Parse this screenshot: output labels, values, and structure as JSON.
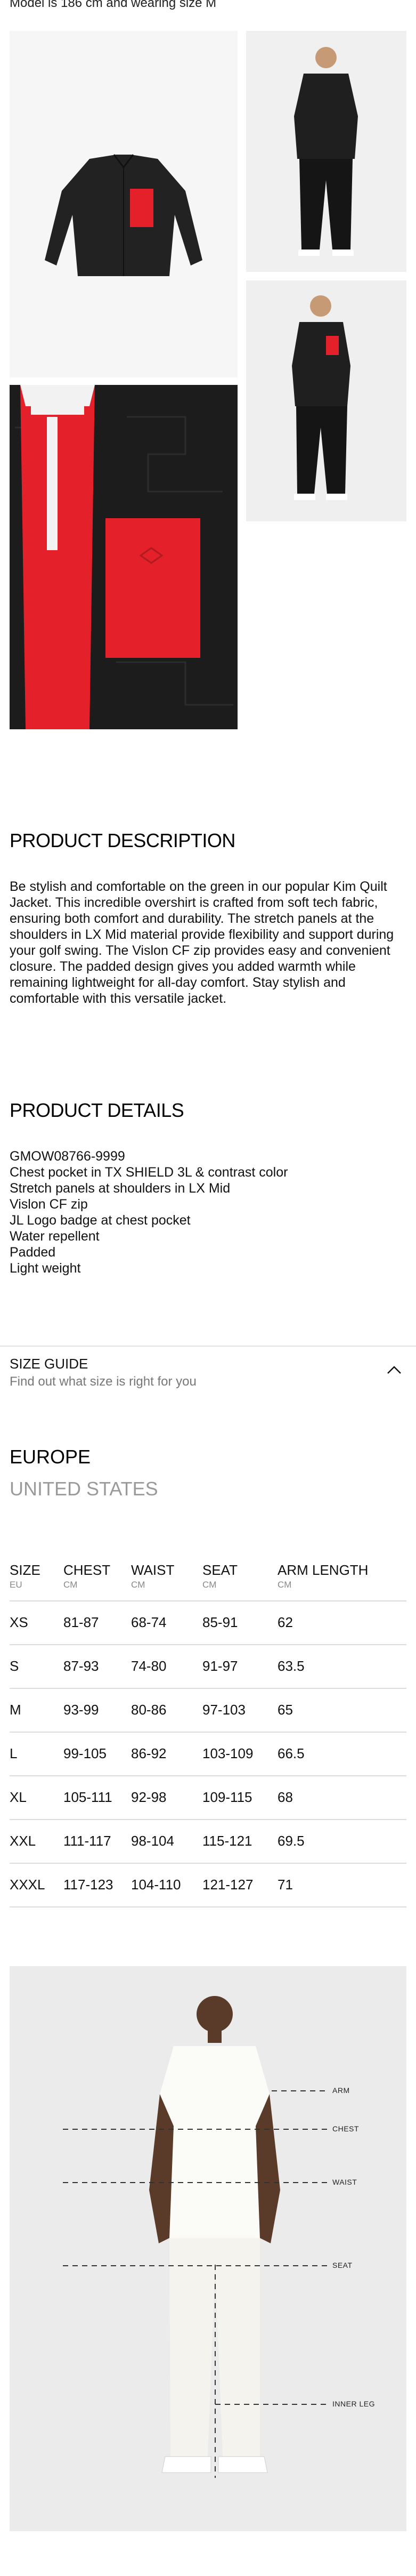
{
  "product": {
    "model_note": "Model is 186 cm and wearing size M",
    "description_title": "PRODUCT DESCRIPTION",
    "description": "Be stylish and comfortable on the green in our popular Kim Quilt Jacket. This incredible overshirt is crafted from soft tech fabric, ensuring both comfort and durability. The stretch panels at the shoulders in LX Mid material provide flexibility and support during your golf swing. The Vislon CF zip provides easy and convenient closure. The padded design gives you added warmth while remaining lightweight for all-day comfort. Stay stylish and comfortable with this versatile jacket.",
    "details_title": "PRODUCT DETAILS",
    "details": [
      "GMOW08766-9999",
      "Chest pocket in TX SHIELD 3L & contrast color",
      "Stretch panels at shoulders in LX Mid",
      "Vislon CF zip",
      "JL Logo badge at chest pocket",
      "Water repellent",
      "Padded",
      "Light weight"
    ]
  },
  "size_guide": {
    "title": "SIZE GUIDE",
    "subtitle": "Find out what size is right for you",
    "regions": [
      "EUROPE",
      "UNITED STATES"
    ],
    "active_region": "EUROPE",
    "columns": [
      {
        "label": "SIZE",
        "unit": "EU"
      },
      {
        "label": "CHEST",
        "unit": "CM"
      },
      {
        "label": "WAIST",
        "unit": "CM"
      },
      {
        "label": "SEAT",
        "unit": "CM"
      },
      {
        "label": "ARM LENGTH",
        "unit": "CM"
      }
    ],
    "rows": [
      [
        "XS",
        "81-87",
        "68-74",
        "85-91",
        "62"
      ],
      [
        "S",
        "87-93",
        "74-80",
        "91-97",
        "63.5"
      ],
      [
        "M",
        "93-99",
        "80-86",
        "97-103",
        "65"
      ],
      [
        "L",
        "99-105",
        "86-92",
        "103-109",
        "66.5"
      ],
      [
        "XL",
        "105-111",
        "92-98",
        "109-115",
        "68"
      ],
      [
        "XXL",
        "111-117",
        "98-104",
        "115-121",
        "69.5"
      ],
      [
        "XXXL",
        "117-123",
        "104-110",
        "121-127",
        "71"
      ]
    ],
    "guide_labels": {
      "arm": "ARM",
      "chest": "CHEST",
      "waist": "WAIST",
      "seat": "SEAT",
      "inner_leg": "INNER LEG"
    }
  },
  "colors": {
    "jacket": "#1f1f1f",
    "pocket": "#e4212a",
    "divider": "#dcdcdc",
    "muted_text": "#9a9a9a"
  }
}
